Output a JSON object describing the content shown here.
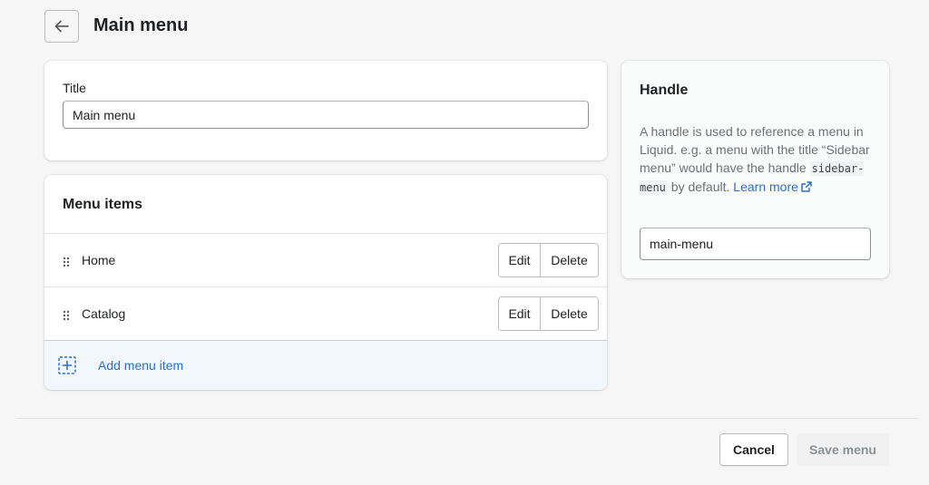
{
  "header": {
    "back_icon": "arrow-left-icon",
    "title": "Main menu"
  },
  "title_card": {
    "label": "Title",
    "value": "Main menu"
  },
  "menu_items": {
    "heading": "Menu items",
    "items": [
      {
        "label": "Home",
        "edit_label": "Edit",
        "delete_label": "Delete"
      },
      {
        "label": "Catalog",
        "edit_label": "Edit",
        "delete_label": "Delete"
      }
    ],
    "add_label": "Add menu item",
    "add_icon": "add-square-icon",
    "drag_icon": "drag-handle-icon"
  },
  "handle_card": {
    "heading": "Handle",
    "desc_before": "A handle is used to reference a menu in Liquid. e.g. a menu with the title “Sidebar menu” would have the handle ",
    "desc_code": "sidebar-menu",
    "desc_after": " by default. ",
    "learn_more": "Learn more",
    "external_icon": "external-link-icon",
    "value": "main-menu"
  },
  "footer": {
    "cancel_label": "Cancel",
    "save_label": "Save menu"
  },
  "colors": {
    "link": "#2c6ecb",
    "add_row_bg": "#f2f7fe",
    "page_bg": "#f6f6f7"
  }
}
